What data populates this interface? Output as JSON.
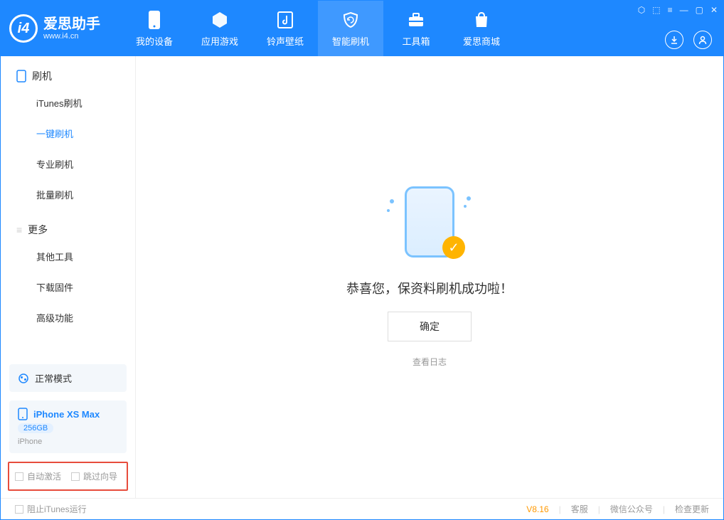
{
  "app": {
    "title": "爱思助手",
    "subtitle": "www.i4.cn"
  },
  "nav": {
    "items": [
      {
        "label": "我的设备"
      },
      {
        "label": "应用游戏"
      },
      {
        "label": "铃声壁纸"
      },
      {
        "label": "智能刷机"
      },
      {
        "label": "工具箱"
      },
      {
        "label": "爱思商城"
      }
    ]
  },
  "sidebar": {
    "section1": "刷机",
    "items1": [
      "iTunes刷机",
      "一键刷机",
      "专业刷机",
      "批量刷机"
    ],
    "section2": "更多",
    "items2": [
      "其他工具",
      "下载固件",
      "高级功能"
    ]
  },
  "mode": {
    "label": "正常模式"
  },
  "device": {
    "name": "iPhone XS Max",
    "capacity": "256GB",
    "type": "iPhone"
  },
  "options": {
    "auto_activate": "自动激活",
    "skip_guide": "跳过向导"
  },
  "main": {
    "success": "恭喜您，保资料刷机成功啦！",
    "confirm": "确定",
    "view_log": "查看日志"
  },
  "footer": {
    "block_itunes": "阻止iTunes运行",
    "version": "V8.16",
    "support": "客服",
    "wechat": "微信公众号",
    "update": "检查更新"
  }
}
